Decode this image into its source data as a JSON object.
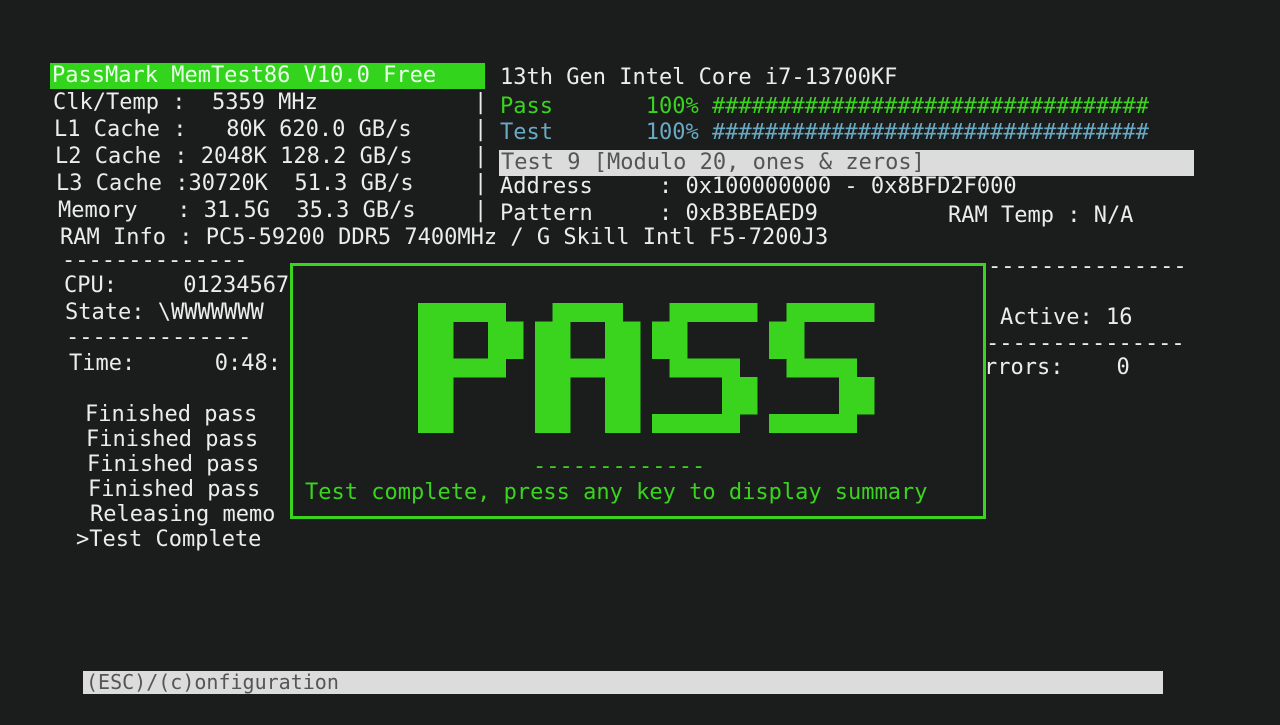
{
  "header": {
    "app_title": "PassMark MemTest86 V10.0 Free",
    "cpu_name": "13th Gen Intel Core i7-13700KF"
  },
  "system_info": [
    {
      "label": "Clk/Temp :",
      "value": "  5359 MHz"
    },
    {
      "label": "L1 Cache :",
      "value": "   80K 620.0 GB/s"
    },
    {
      "label": "L2 Cache :",
      "value": " 2048K 128.2 GB/s"
    },
    {
      "label": "L3 Cache :",
      "value": "30720K  51.3 GB/s"
    },
    {
      "label": "Memory   :",
      "value": " 31.5G  35.3 GB/s"
    }
  ],
  "ram_info": "RAM Info : PC5-59200 DDR5 7400MHz / G Skill Intl F5-7200J3",
  "progress": {
    "pass": {
      "label": "Pass",
      "percent": 100,
      "percent_text": "100%",
      "bar": "#################################",
      "color": "#3ad41e"
    },
    "test": {
      "label": "Test",
      "percent": 100,
      "percent_text": "100%",
      "bar": "#################################",
      "color": "#6aa9c2"
    }
  },
  "current_test": "Test 9 [Modulo 20, ones & zeros]",
  "address": {
    "label": "Address",
    "value": ": 0x100000000 - 0x8BFD2F000"
  },
  "pattern": {
    "label": "Pattern",
    "value": ": 0xB3BEAED9"
  },
  "ram_temp": "RAM Temp : N/A",
  "cpu_panel": {
    "separator": "--------------",
    "cpu_label": "CPU:",
    "cpu_value": "01234567",
    "state_label": "State:",
    "state_value": "\\WWWWWWW",
    "time_label": "Time:",
    "time_value": "0:48:"
  },
  "right_panel": {
    "separator": "---------------",
    "active": "Active: 16",
    "errors_label": "rrors:",
    "errors_value": "0"
  },
  "log": [
    "Finished pass",
    "Finished pass",
    "Finished pass",
    "Finished pass",
    "Releasing memo",
    ">Test Complete"
  ],
  "result_overlay": {
    "result": "PASS",
    "separator": "-------------",
    "message": "Test complete, press any key to display summary",
    "color": "#3ad41e"
  },
  "footer": {
    "hint": "(ESC)/(c)onfiguration"
  }
}
